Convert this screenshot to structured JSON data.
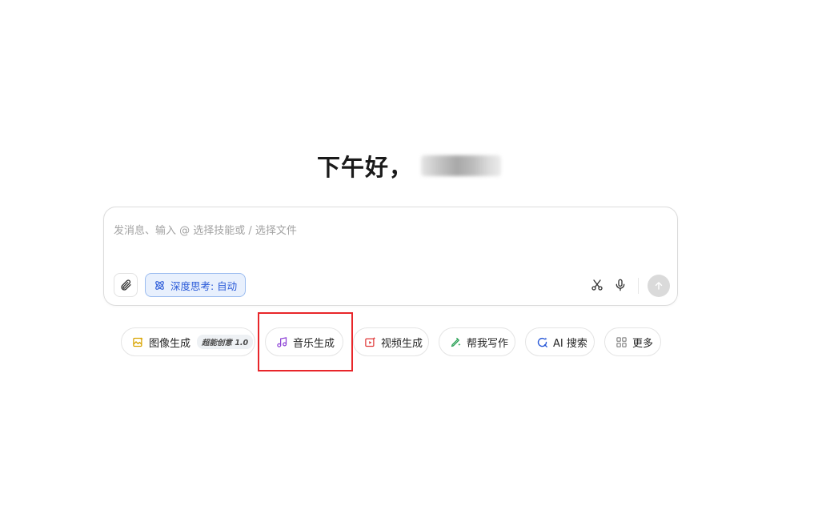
{
  "greeting": {
    "text": "下午好，"
  },
  "composer": {
    "placeholder": "发消息、输入 @ 选择技能或 / 选择文件",
    "value": "",
    "deep_think_label": "深度思考: 自动"
  },
  "quick_actions": [
    {
      "label": "图像生成",
      "badge": "超能创意 1.0",
      "icon": "image-gen-icon",
      "color": "#d9a400"
    },
    {
      "label": "音乐生成",
      "icon": "music-note-icon",
      "color": "#8e44d6"
    },
    {
      "label": "视频生成",
      "icon": "video-gen-icon",
      "color": "#e03b3b"
    },
    {
      "label": "帮我写作",
      "icon": "pen-icon",
      "color": "#2fa35a"
    },
    {
      "label": "AI 搜索",
      "icon": "search-icon",
      "color": "#2a5ad8"
    },
    {
      "label": "更多",
      "icon": "grid-more-icon",
      "color": "#8c8c8c"
    }
  ],
  "colors": {
    "accent": "#2a5ad8",
    "highlight": "#e8262a",
    "send_disabled": "#dadada"
  }
}
